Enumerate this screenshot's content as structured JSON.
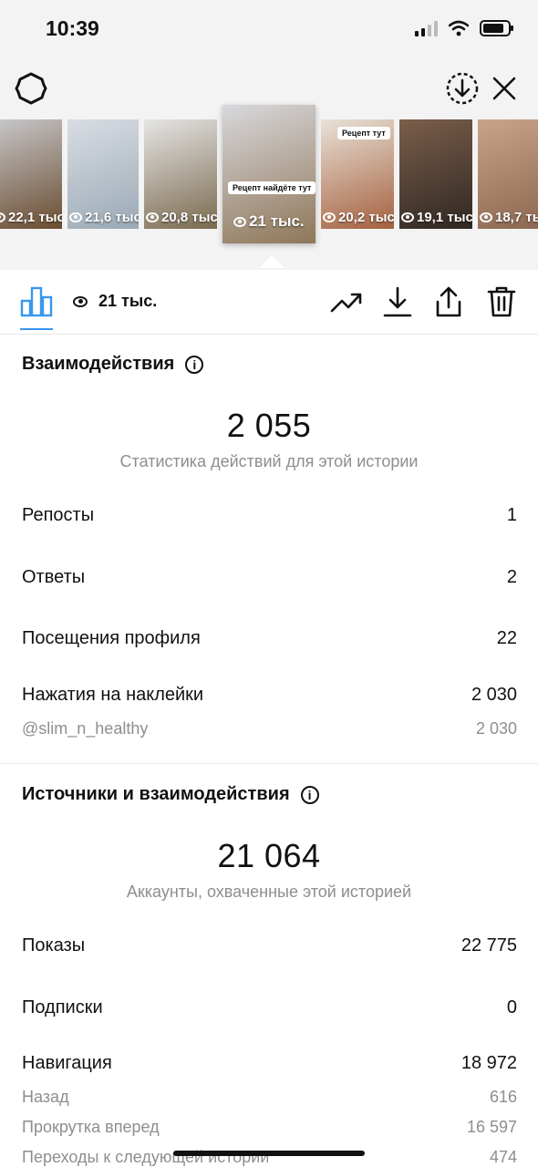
{
  "status_bar": {
    "time": "10:39"
  },
  "story_strip": {
    "thumbnails": [
      {
        "views": "22,1 тыс",
        "colors": [
          "#c8c8cc",
          "#6a4c2f"
        ]
      },
      {
        "views": "21,6 тыс",
        "colors": [
          "#d9dde3",
          "#9aa9b5"
        ]
      },
      {
        "views": "20,8 тыс",
        "colors": [
          "#e5e5e5",
          "#7b6a4e"
        ]
      },
      {
        "views": "21 тыс.",
        "sticker": "Рецепт найдёте тут",
        "selected": true,
        "colors": [
          "#d8d8dc",
          "#8f7658"
        ]
      },
      {
        "views": "20,2 тыс",
        "sticker": "Рецепт тут",
        "colors": [
          "#e8e2d8",
          "#a5603f"
        ]
      },
      {
        "views": "19,1 тыс",
        "colors": [
          "#7b5e4a",
          "#2f2722"
        ]
      },
      {
        "views": "18,7 тыс",
        "colors": [
          "#c9a48a",
          "#8a6650"
        ]
      }
    ]
  },
  "toolbar": {
    "views_label": "21 тыс."
  },
  "interactions": {
    "title": "Взаимодействия",
    "total": "2 055",
    "caption": "Статистика действий для этой истории",
    "rows": [
      {
        "label": "Репосты",
        "value": "1"
      },
      {
        "label": "Ответы",
        "value": "2"
      },
      {
        "label": "Посещения профиля",
        "value": "22"
      },
      {
        "label": "Нажатия на наклейки",
        "value": "2 030"
      }
    ],
    "sub_rows": [
      {
        "label": "@slim_n_healthy",
        "value": "2 030"
      }
    ]
  },
  "discovery": {
    "title": "Источники и взаимодействия",
    "total": "21 064",
    "caption": "Аккаунты, охваченные этой историей",
    "rows": [
      {
        "label": "Показы",
        "value": "22 775"
      },
      {
        "label": "Подписки",
        "value": "0"
      },
      {
        "label": "Навигация",
        "value": "18 972"
      }
    ],
    "sub_rows": [
      {
        "label": "Назад",
        "value": "616"
      },
      {
        "label": "Прокрутка вперед",
        "value": "16 597"
      },
      {
        "label": "Переходы к следующей истории",
        "value": "474"
      }
    ]
  },
  "colors": {
    "accent": "#3897f0",
    "muted_text": "#8e8e8e"
  }
}
